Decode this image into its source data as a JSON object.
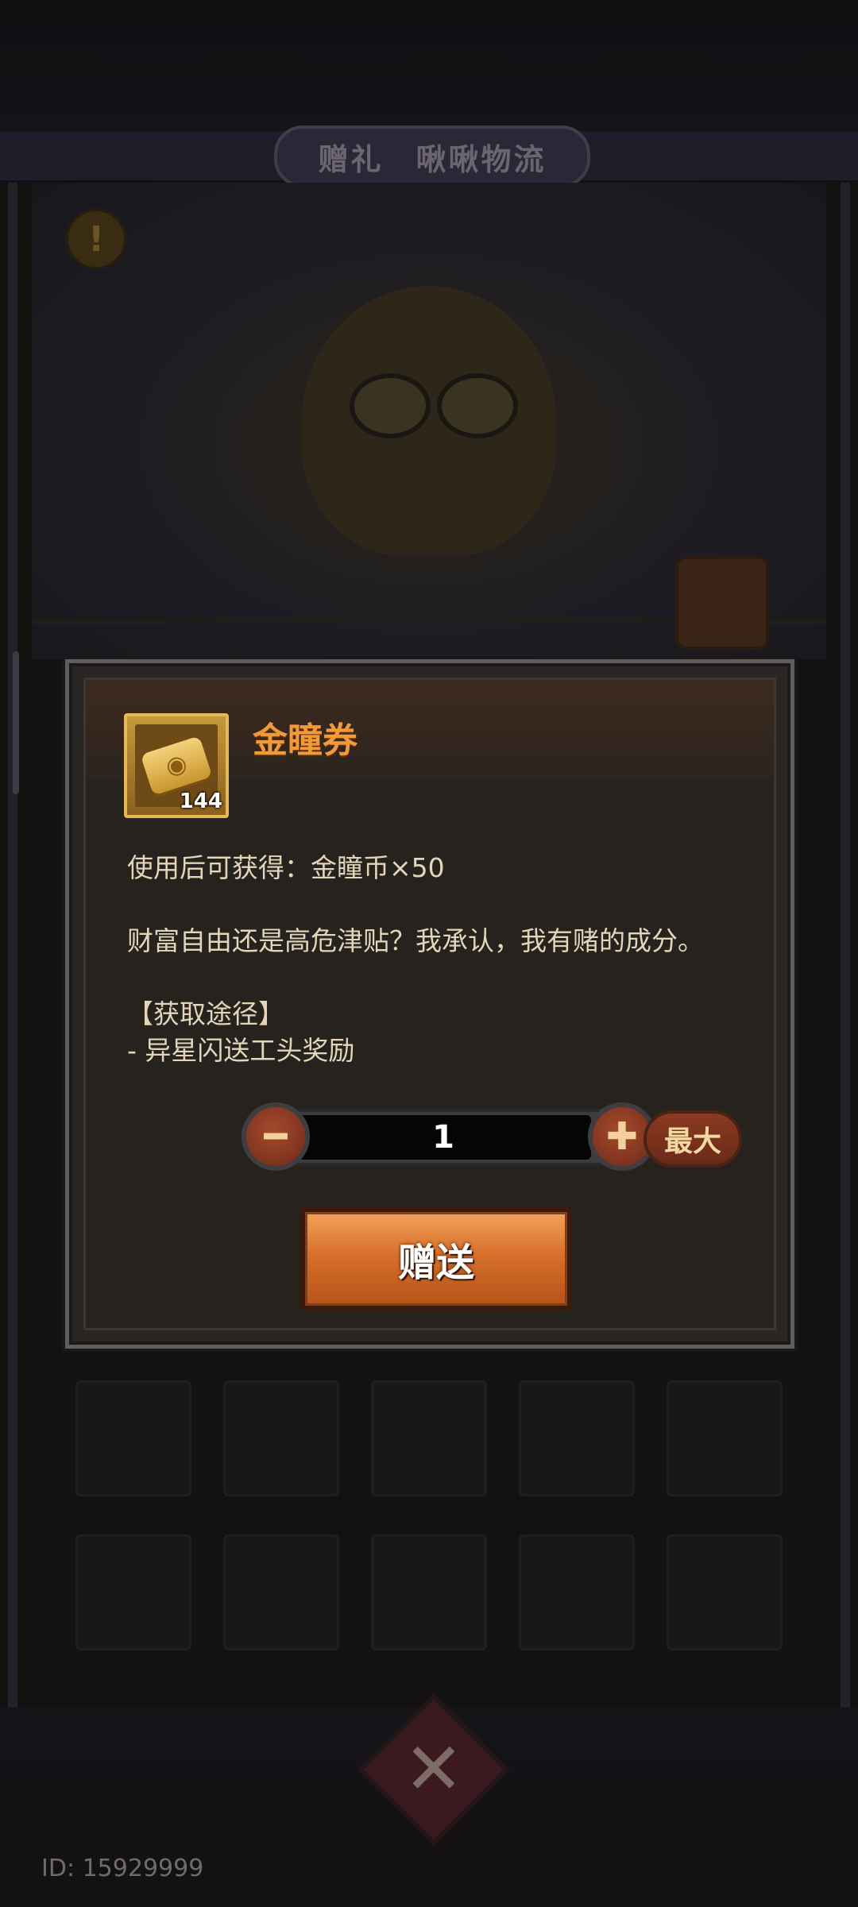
{
  "header": {
    "title": "赠礼　啾啾物流"
  },
  "dialog": {
    "item": {
      "name": "金瞳券",
      "count": "144",
      "icon": "gold-ticket-icon"
    },
    "description": {
      "obtain_text": "使用后可获得：金瞳币×50",
      "flavor_text": "财富自由还是高危津贴？我承认，我有赌的成分。",
      "source_heading": "【获取途径】",
      "source_item": "- 异星闪送工头奖励"
    },
    "quantity": {
      "value": "1",
      "minus_icon": "minus-icon",
      "plus_icon": "plus-icon",
      "max_label": "最大"
    },
    "gift_button_label": "赠送"
  },
  "footer": {
    "user_id": "ID: 15929999"
  },
  "colors": {
    "accent_orange": "#f29a3a",
    "button_orange": "#d8702c",
    "button_red": "#8a3a22",
    "dialog_bg": "#26231f"
  }
}
